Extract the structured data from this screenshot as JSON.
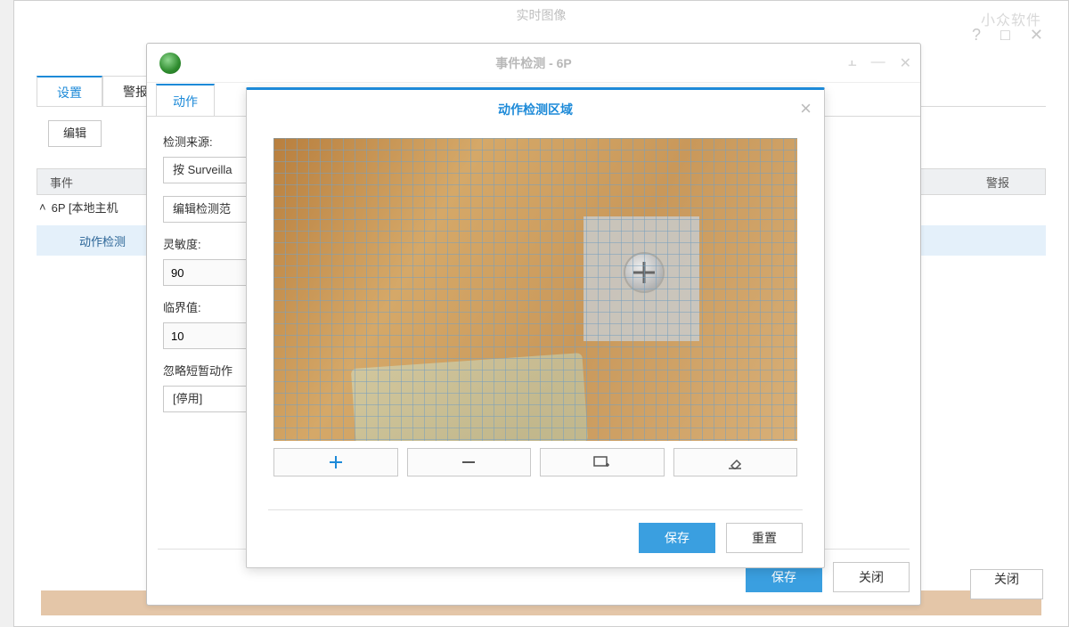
{
  "bg": {
    "title": "实时图像",
    "watermark": "小众软件",
    "tabs": {
      "settings": "设置",
      "alerts": "警报历"
    },
    "edit": "编辑",
    "col_event": "事件",
    "col_alert": "警报",
    "node": "6P [本地主机",
    "leaf": "动作检测",
    "close": "关闭"
  },
  "mid": {
    "title": "事件检测 - 6P",
    "tab": "动作",
    "source_label": "检测来源:",
    "source_value": "按 Surveilla",
    "edit_area": "编辑检测范",
    "sensitivity_label": "灵敏度:",
    "sensitivity_value": "90",
    "threshold_label": "临界值:",
    "threshold_value": "10",
    "ignore_label": "忽略短暂动作",
    "ignore_value": "[停用]",
    "save": "保存",
    "close": "关闭"
  },
  "modal": {
    "title": "动作检测区域",
    "save": "保存",
    "reset": "重置"
  }
}
